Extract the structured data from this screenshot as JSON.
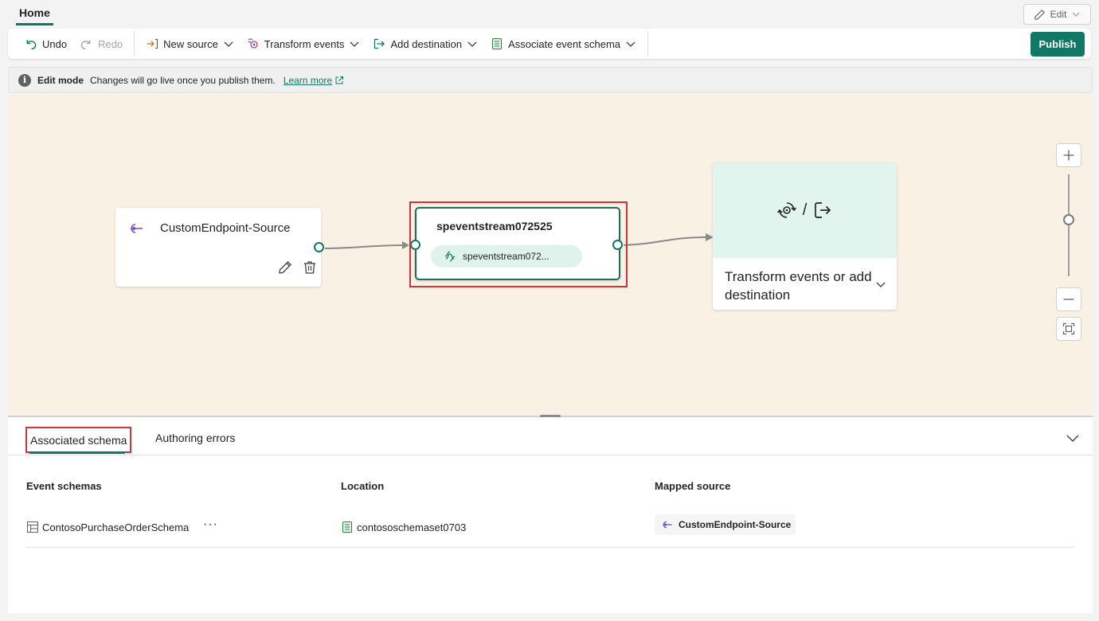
{
  "top": {
    "home_tab": "Home",
    "edit_label": "Edit"
  },
  "toolbar": {
    "undo": "Undo",
    "redo": "Redo",
    "new_source": "New source",
    "transform_events": "Transform events",
    "add_destination": "Add destination",
    "associate_event_schema": "Associate event schema",
    "publish": "Publish"
  },
  "infobar": {
    "title": "Edit mode",
    "message": "Changes will go live once you publish them.",
    "link": "Learn more"
  },
  "canvas": {
    "source_node": {
      "label": "CustomEndpoint-Source"
    },
    "stream_node": {
      "title": "speventstream072525",
      "pill": "speventstream072..."
    },
    "destination_node": {
      "text": "Transform events or add destination",
      "separator": "/"
    }
  },
  "bottom_panel": {
    "tabs": [
      "Associated schema",
      "Authoring errors"
    ],
    "columns": [
      "Event schemas",
      "Location",
      "Mapped source"
    ],
    "rows": [
      {
        "schema": "ContosoPurchaseOrderSchema",
        "more": "···",
        "location": "contososchemaset0703",
        "mapped_source": "CustomEndpoint-Source"
      }
    ]
  },
  "colors": {
    "accent": "#117865",
    "highlight": "#d13438",
    "canvas_bg": "#f9f1e3",
    "dest_bg": "#e1f5ee",
    "source_icon": "#7a55c9"
  },
  "icons": [
    "undo-icon",
    "redo-icon",
    "new-source-icon",
    "transform-icon",
    "add-destination-icon",
    "schema-icon",
    "pencil-icon",
    "info-icon",
    "external-link-icon",
    "source-endpoint-icon",
    "delete-icon",
    "stream-icon",
    "transform-gear-icon",
    "export-icon",
    "chevron-down-icon",
    "zoom-in-icon",
    "zoom-out-icon",
    "fit-view-icon",
    "table-icon"
  ]
}
